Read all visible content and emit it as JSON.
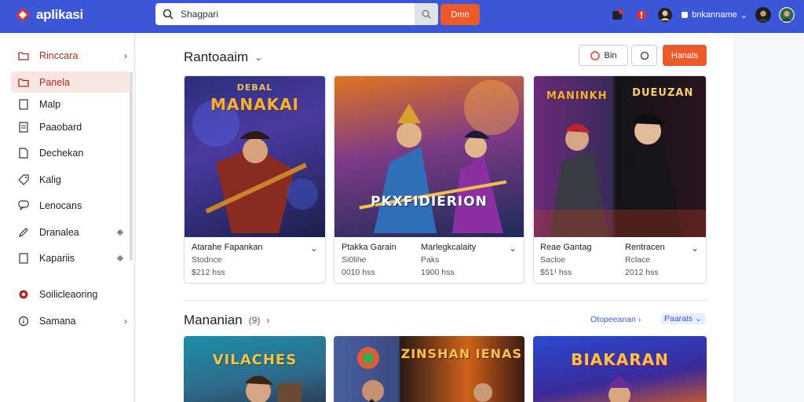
{
  "app": {
    "name": "aplikasi"
  },
  "search": {
    "value": "Shagpari"
  },
  "top": {
    "button_label": "Dmn",
    "username": "bnkanname"
  },
  "sidebar": {
    "items": [
      {
        "label": "Rinccara",
        "icon": "folder-icon"
      },
      {
        "label": "Panela",
        "icon": "folder-icon"
      },
      {
        "label": "Malp",
        "icon": "document-icon"
      },
      {
        "label": "Paaobard",
        "icon": "document-icon"
      },
      {
        "label": "Dechekan",
        "icon": "document-icon"
      },
      {
        "label": "Kalig",
        "icon": "tag-icon"
      },
      {
        "label": "Lenocans",
        "icon": "chat-icon"
      },
      {
        "label": "Dranalea",
        "icon": "edit-icon"
      },
      {
        "label": "Kapariis",
        "icon": "document-icon"
      },
      {
        "label": "Soilicleaoring",
        "icon": "gear-icon"
      },
      {
        "label": "Samana",
        "icon": "info-icon"
      }
    ]
  },
  "section1": {
    "title": "Rantoaaim",
    "filter_button": "Bin",
    "action_button": "Hanals",
    "cards": [
      {
        "art_title": "MANAKAI",
        "art_kicker": "DEBAL",
        "name": "Atarahe Fapankan",
        "name2": "",
        "sub": "Stodnce",
        "sub2": "",
        "price": "$212 hss",
        "price2": ""
      },
      {
        "art_title": "PKXFIDIERION",
        "art_kicker": "",
        "name": "Ptakka Garain",
        "name2": "Marlegkcalaity",
        "sub": "Si0lihe",
        "sub2": "Paks",
        "price": "0010 hss",
        "price2": "1900 hss"
      },
      {
        "art_title": "MANINKH",
        "art_kicker": "DUEUZAN",
        "name": "Reae Gantag",
        "name2": "Rentracen",
        "sub": "Sacloe",
        "sub2": "Rclace",
        "price": "$51¹ hss",
        "price2": "2012 hss"
      }
    ]
  },
  "section2": {
    "title": "Mananian",
    "count": "(9)",
    "link1": "Otopeeanan",
    "link2": "Paarats",
    "cards": [
      {
        "art_title": "VILACHES"
      },
      {
        "art_title": "ZINSHAN IENAS"
      },
      {
        "art_title": "BIAKARAN"
      }
    ]
  },
  "colors": {
    "topbar": "#3b56d6",
    "accent": "#ec5a2a",
    "active": "#f8e6e3"
  }
}
